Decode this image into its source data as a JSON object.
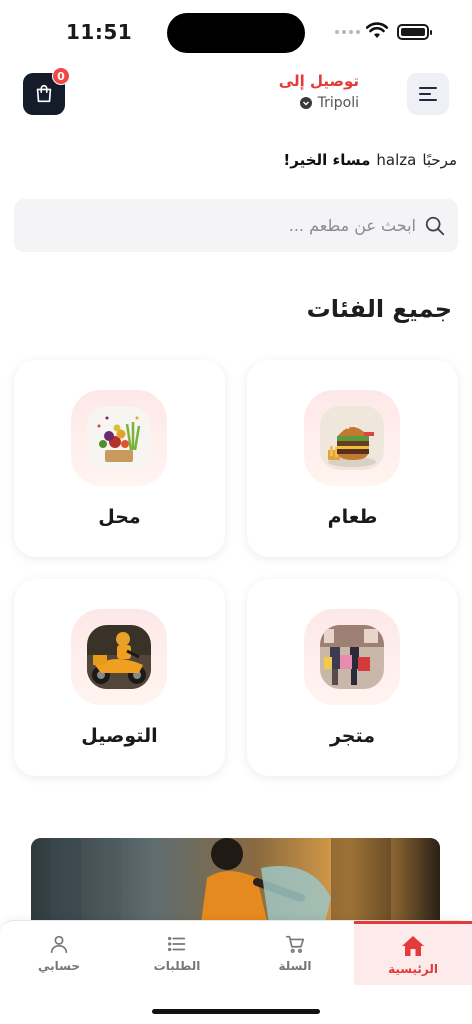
{
  "status": {
    "time": "11:51"
  },
  "header": {
    "cart_count": "0",
    "deliver_title": "توصيل إلى",
    "location": "Tripoli"
  },
  "greeting": {
    "welcome": "مرحبًا",
    "name": "halza",
    "salutation": "مساء الخير!"
  },
  "search": {
    "placeholder": "ابحث عن مطعم ..."
  },
  "categories": {
    "title": "جميع الفئات",
    "items": [
      {
        "label": "طعام",
        "icon": "burger-image"
      },
      {
        "label": "محل",
        "icon": "vegetables-image"
      },
      {
        "label": "متجر",
        "icon": "shopping-image"
      },
      {
        "label": "التوصيل",
        "icon": "delivery-scooter-image"
      }
    ]
  },
  "nav": {
    "items": [
      {
        "label": "الرئيسية",
        "icon": "home-icon",
        "active": true
      },
      {
        "label": "السلة",
        "icon": "cart-icon"
      },
      {
        "label": "الطلبات",
        "icon": "list-icon"
      },
      {
        "label": "حسابي",
        "icon": "user-icon"
      }
    ]
  },
  "colors": {
    "accent": "#e23b3b",
    "dark": "#141b2b",
    "badge": "#f04747"
  }
}
